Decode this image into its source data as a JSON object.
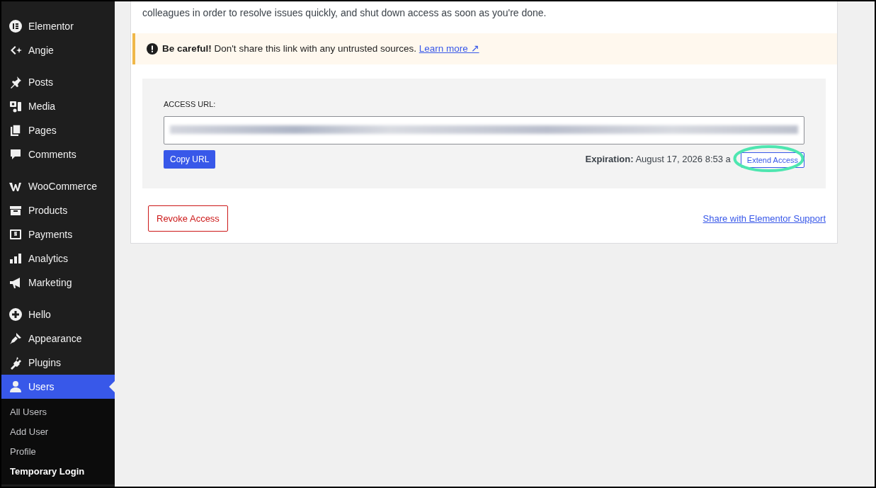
{
  "sidebar": {
    "groups": [
      [
        {
          "label": "Elementor",
          "selected": false
        },
        {
          "label": "Angie",
          "selected": false
        }
      ],
      [
        {
          "label": "Posts",
          "selected": false
        },
        {
          "label": "Media",
          "selected": false
        },
        {
          "label": "Pages",
          "selected": false
        },
        {
          "label": "Comments",
          "selected": false
        }
      ],
      [
        {
          "label": "WooCommerce",
          "selected": false
        },
        {
          "label": "Products",
          "selected": false
        },
        {
          "label": "Payments",
          "selected": false
        },
        {
          "label": "Analytics",
          "selected": false
        },
        {
          "label": "Marketing",
          "selected": false
        }
      ],
      [
        {
          "label": "Hello",
          "selected": false
        },
        {
          "label": "Appearance",
          "selected": false
        },
        {
          "label": "Plugins",
          "selected": false
        },
        {
          "label": "Users",
          "selected": true,
          "submenu": [
            {
              "label": "All Users",
              "selected": false
            },
            {
              "label": "Add User",
              "selected": false
            },
            {
              "label": "Profile",
              "selected": false
            },
            {
              "label": "Temporary Login",
              "selected": true
            }
          ]
        }
      ]
    ]
  },
  "intro": "colleagues in order to resolve issues quickly, and shut down access as soon as you're done.",
  "notice": {
    "text": "**Be careful!** Don't share this link with any untrusted sources.",
    "link": "Learn more ↗"
  },
  "access": {
    "label": "ACCESS URL:",
    "copy_button": "Copy URL",
    "expiration": "**Expiration:** August 17, 2026 8:53 a",
    "extend_button": "Extend Access",
    "highlighted": true
  },
  "revoke_button": "Revoke Access",
  "share_link": "Share with Elementor Support"
}
